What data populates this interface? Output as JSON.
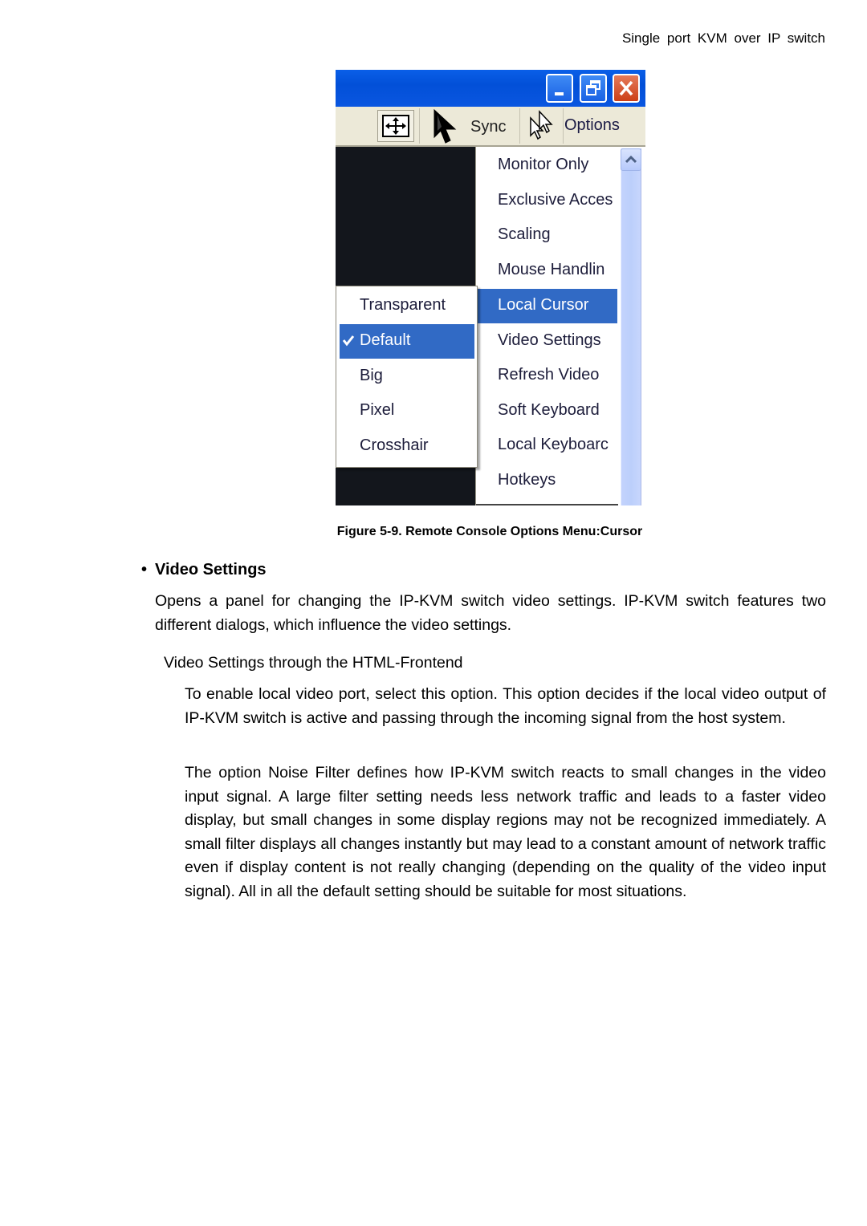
{
  "page_header": "Single port KVM over IP switch",
  "figure": {
    "window_buttons": {
      "minimize": "minimize-icon",
      "restore": "restore-icon",
      "close": "close-icon"
    },
    "toolbar": {
      "move_icon": "move-arrows-icon",
      "sync_label": "Sync",
      "local_cursor_icon": "double-cursor-icon",
      "options_label": "Options"
    },
    "options_menu": {
      "items": [
        {
          "label": "Monitor Only",
          "selected": false
        },
        {
          "label": "Exclusive Access",
          "visible_text": "Exclusive Acces",
          "selected": false
        },
        {
          "label": "Scaling",
          "selected": false
        },
        {
          "label": "Mouse Handling",
          "visible_text": "Mouse Handlin",
          "selected": false
        },
        {
          "label": "Local Cursor",
          "selected": true
        },
        {
          "label": "Video Settings",
          "selected": false
        },
        {
          "label": "Refresh Video",
          "selected": false
        },
        {
          "label": "Soft Keyboard",
          "selected": false
        },
        {
          "label": "Local Keyboard",
          "visible_text": "Local Keyboarc",
          "selected": false
        },
        {
          "label": "Hotkeys",
          "selected": false
        }
      ]
    },
    "cursor_submenu": {
      "items": [
        {
          "label": "Transparent",
          "checked": false
        },
        {
          "label": "Default",
          "checked": true
        },
        {
          "label": "Big",
          "checked": false
        },
        {
          "label": "Pixel",
          "checked": false
        },
        {
          "label": "Crosshair",
          "checked": false
        }
      ]
    },
    "colors": {
      "highlight": "#316ac5",
      "titlebar": "#0a5fe8",
      "toolbar_bg": "#ece9d8"
    }
  },
  "caption": "Figure 5-9. Remote Console Options Menu:Cursor",
  "section": {
    "bullet": "•",
    "heading": "Video Settings",
    "intro": "Opens a panel for changing the IP-KVM switch video settings. IP-KVM switch features two different dialogs, which influence the video settings.",
    "subheading": "Video Settings through the HTML-Frontend",
    "para_local_video": "To enable local video port, select this option. This option decides if the local video output of IP-KVM switch is active and passing through the incoming signal from the host system.",
    "para_noise_filter": "The option Noise Filter defines how IP-KVM switch reacts to small changes in the video input signal. A large filter setting needs less network traffic and leads to a faster video display, but small changes in some display regions may not be recognized immediately. A small filter displays all changes instantly but may lead to a constant amount of network traffic even if display content is not really changing (depending on the quality of the video input signal). All in all the default setting should be suitable for most situations."
  }
}
